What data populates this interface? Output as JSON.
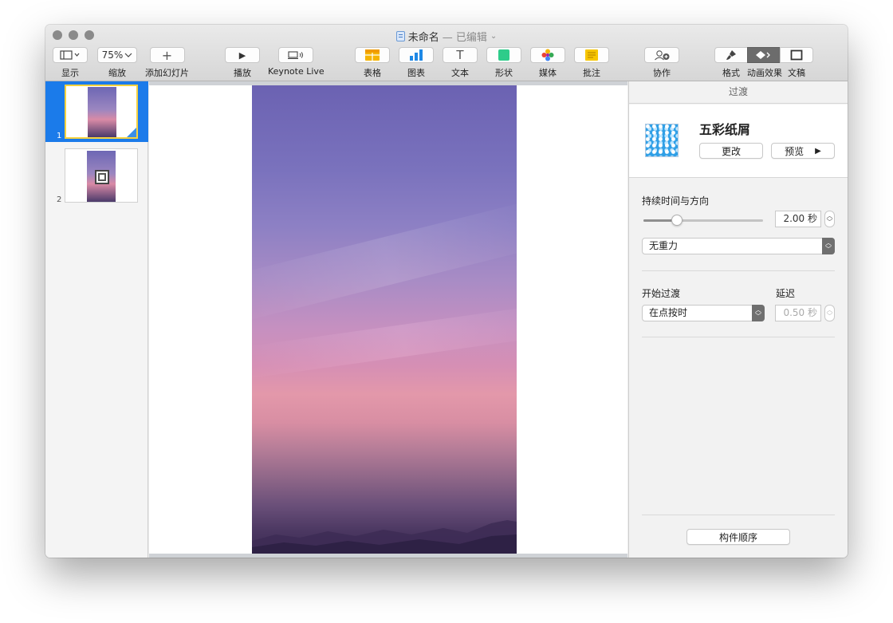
{
  "window": {
    "title": "未命名",
    "status": "— 已编辑",
    "title_chevron": "⌄"
  },
  "toolbar": {
    "view_label": "显示",
    "zoom_value": "75%",
    "zoom_label": "缩放",
    "add_slide_label": "添加幻灯片",
    "add_slide_glyph": "+",
    "play_label": "播放",
    "play_glyph": "▶",
    "keynote_live_label": "Keynote Live",
    "table_label": "表格",
    "chart_label": "图表",
    "text_label": "文本",
    "text_glyph": "T",
    "shape_label": "形状",
    "media_label": "媒体",
    "comment_label": "批注",
    "collaborate_label": "协作",
    "format_label": "格式",
    "animate_label": "动画效果",
    "document_label": "文稿"
  },
  "navigator": {
    "slides": [
      {
        "number": "1"
      },
      {
        "number": "2"
      }
    ]
  },
  "inspector": {
    "header": "过渡",
    "effect_name": "五彩纸屑",
    "change_button": "更改",
    "preview_button": "预览",
    "preview_glyph": "▶",
    "duration_label": "持续时间与方向",
    "duration_value": "2.00 秒",
    "duration_fraction": 0.28,
    "direction_value": "无重力",
    "start_label": "开始过渡",
    "start_value": "在点按时",
    "delay_label": "延迟",
    "delay_value": "0.50 秒",
    "build_order_button": "构件顺序"
  },
  "colors": {
    "selection_blue": "#1b7bea",
    "selected_thumb_border": "#f7d23e",
    "active_segment": "#6c6c6c"
  }
}
